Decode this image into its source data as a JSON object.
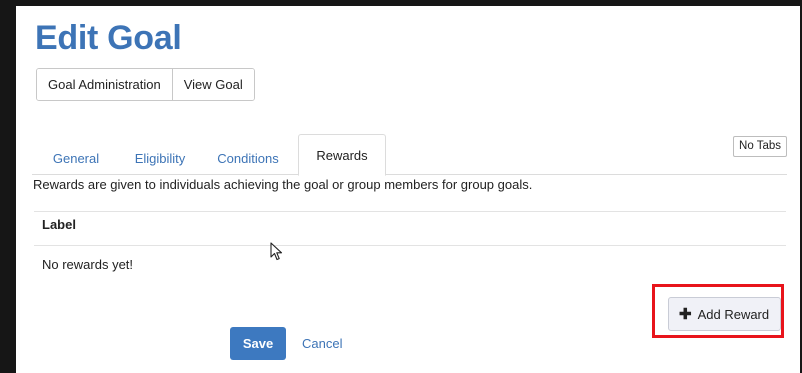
{
  "header": {
    "title": "Edit Goal",
    "nav": [
      "Goal Administration",
      "View Goal"
    ]
  },
  "tabs": {
    "items": [
      "General",
      "Eligibility",
      "Conditions",
      "Rewards"
    ],
    "active": "Rewards",
    "no_tabs_label": "No Tabs"
  },
  "rewards": {
    "description": "Rewards are given to individuals achieving the goal or group members for group goals.",
    "column_label": "Label",
    "empty_text": "No rewards yet!",
    "add_label": "Add Reward"
  },
  "form": {
    "save_label": "Save",
    "cancel_label": "Cancel"
  },
  "colors": {
    "accent": "#3d74b6",
    "highlight": "#e8141b",
    "background_dark": "#161616"
  },
  "icons": {
    "add": "plus-icon",
    "pointer": "mouse-cursor-icon"
  }
}
